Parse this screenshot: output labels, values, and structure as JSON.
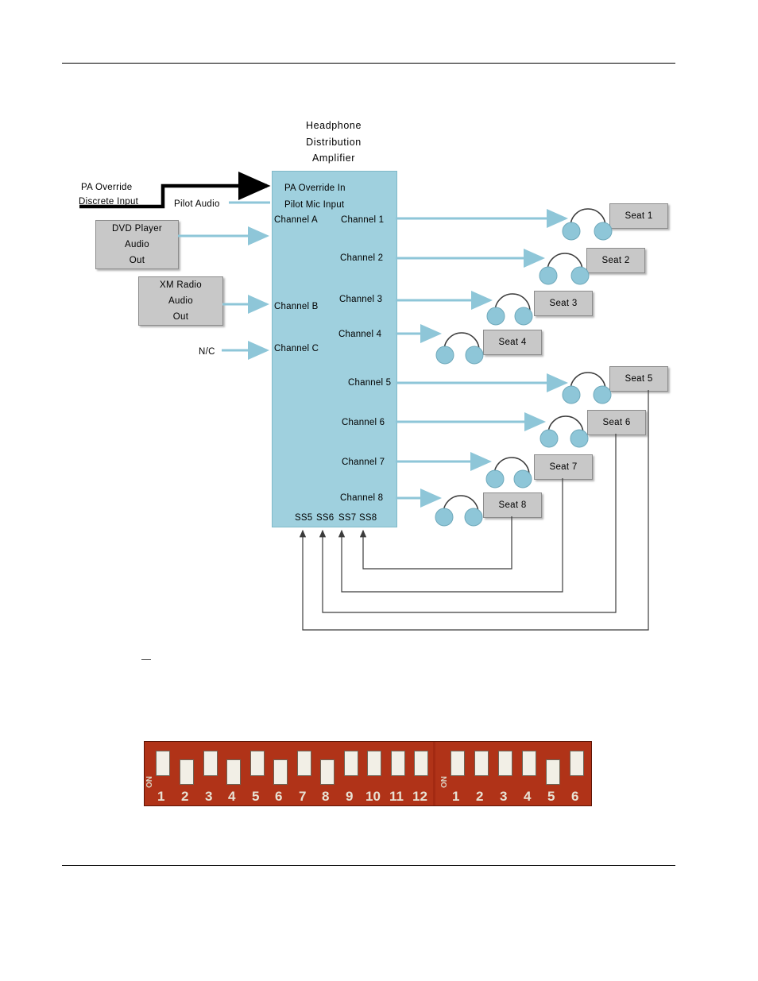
{
  "document": {
    "amplifier_title_lines": [
      "Headphone",
      "Distribution",
      "Amplifier"
    ]
  },
  "amplifier": {
    "inputs": [
      {
        "id": "pa-override-in",
        "label": "PA Override In"
      },
      {
        "id": "pilot-mic-input",
        "label": "Pilot Mic Input"
      },
      {
        "id": "channel-a",
        "label": "Channel A"
      },
      {
        "id": "channel-b",
        "label": "Channel B"
      },
      {
        "id": "channel-c",
        "label": "Channel C"
      }
    ],
    "outputs": [
      {
        "id": "channel-1",
        "label": "Channel 1"
      },
      {
        "id": "channel-2",
        "label": "Channel 2"
      },
      {
        "id": "channel-3",
        "label": "Channel 3"
      },
      {
        "id": "channel-4",
        "label": "Channel 4"
      },
      {
        "id": "channel-5",
        "label": "Channel 5"
      },
      {
        "id": "channel-6",
        "label": "Channel 6"
      },
      {
        "id": "channel-7",
        "label": "Channel 7"
      },
      {
        "id": "channel-8",
        "label": "Channel 8"
      }
    ],
    "seat_select_labels": [
      "SS5",
      "SS6",
      "SS7",
      "SS8"
    ],
    "fill_color": "#9fd0de"
  },
  "sources": {
    "pa_override_line1": "PA Override",
    "pa_override_line2": "Discrete Input",
    "pilot_audio": "Pilot Audio",
    "dvd_player_lines": [
      "DVD Player",
      "Audio",
      "Out"
    ],
    "xm_radio_lines": [
      "XM Radio",
      "Audio",
      "Out"
    ],
    "nc_label": "N/C"
  },
  "seats": [
    {
      "label": "Seat 1"
    },
    {
      "label": "Seat 2"
    },
    {
      "label": "Seat 3"
    },
    {
      "label": "Seat 4"
    },
    {
      "label": "Seat 5"
    },
    {
      "label": "Seat 6"
    },
    {
      "label": "Seat 7"
    },
    {
      "label": "Seat 8"
    }
  ],
  "dip_photo": {
    "bank_left_numbers": [
      "1",
      "2",
      "3",
      "4",
      "5",
      "6",
      "7",
      "8",
      "9",
      "10",
      "11",
      "12"
    ],
    "bank_right_numbers": [
      "1",
      "2",
      "3",
      "4",
      "5",
      "6"
    ],
    "on_label": "ON"
  }
}
